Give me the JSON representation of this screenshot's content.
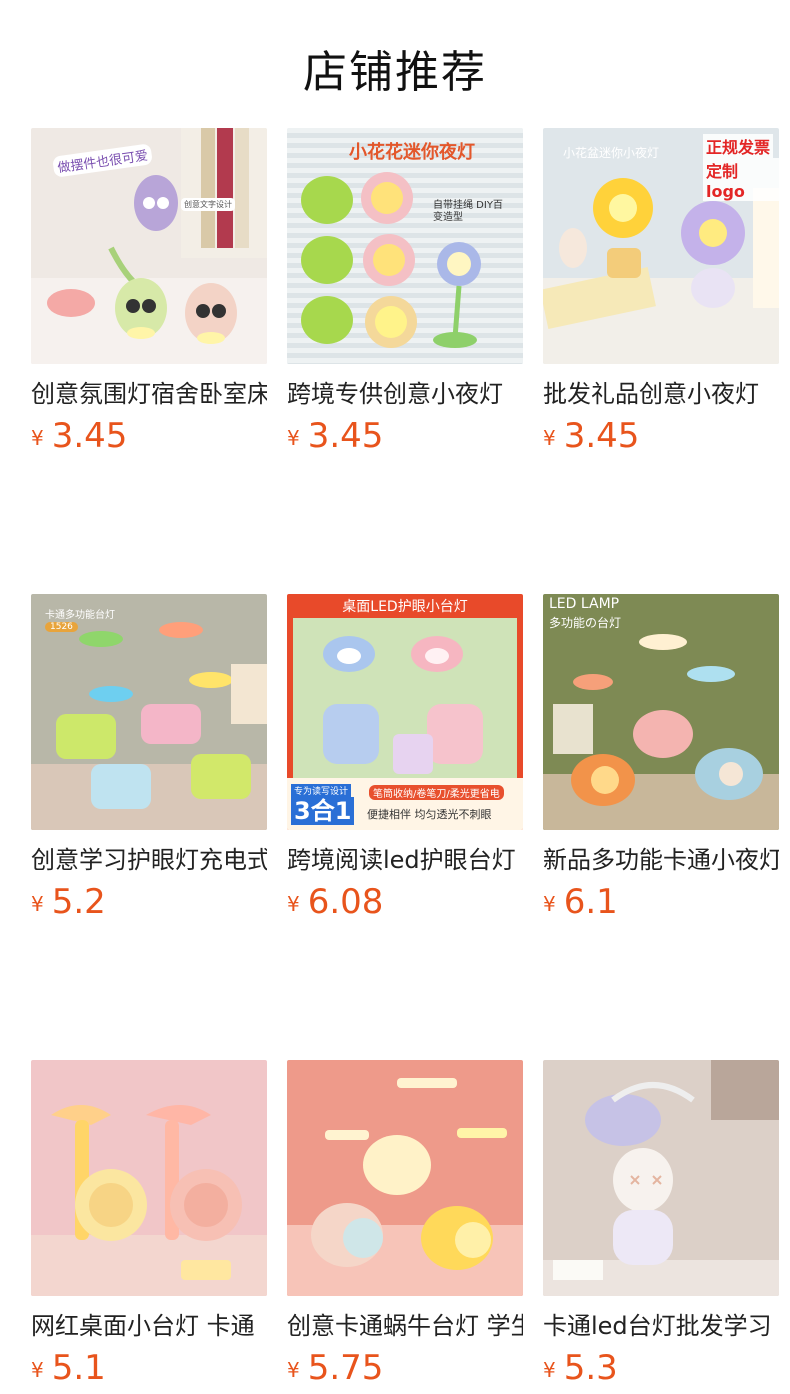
{
  "page": {
    "title": "店铺推荐"
  },
  "products": [
    {
      "name": "创意氛围灯宿舍卧室床头",
      "currency": "¥",
      "price": "3.45",
      "image": {
        "caption": "做摆件也很可爱",
        "alt_caption": "创意文字设计"
      }
    },
    {
      "name": "跨境专供创意小夜灯",
      "currency": "¥",
      "price": "3.45",
      "image": {
        "caption": "小花花迷你夜灯",
        "alt_caption": "自带挂绳 DIY百变造型"
      }
    },
    {
      "name": "批发礼品创意小夜灯",
      "currency": "¥",
      "price": "3.45",
      "image": {
        "caption": "小花盆迷你小夜灯",
        "badge_line1": "正规发票",
        "badge_line2": "定制logo"
      }
    },
    {
      "name": "创意学习护眼灯充电式",
      "currency": "¥",
      "price": "5.2",
      "image": {
        "caption": "卡通多功能台灯",
        "tag": "1526"
      }
    },
    {
      "name": "跨境阅读led护眼台灯",
      "currency": "¥",
      "price": "6.08",
      "image": {
        "caption": "桌面LED护眼小台灯",
        "tag": "专为读写设计",
        "tag_big": "3合1",
        "sub1": "笔筒收纳/卷笔刀/柔光更省电",
        "sub2": "便捷相伴 均匀透光不刺眼"
      }
    },
    {
      "name": "新品多功能卡通小夜灯",
      "currency": "¥",
      "price": "6.1",
      "image": {
        "caption": "LED LAMP",
        "sub1": "多功能の台灯"
      }
    },
    {
      "name": "网红桌面小台灯 卡通",
      "currency": "¥",
      "price": "5.1",
      "image": {}
    },
    {
      "name": "创意卡通蜗牛台灯 学生",
      "currency": "¥",
      "price": "5.75",
      "image": {}
    },
    {
      "name": "卡通led台灯批发学习",
      "currency": "¥",
      "price": "5.3",
      "image": {}
    }
  ],
  "colors": {
    "price": "#e8541c",
    "title": "#111111",
    "name": "#222222"
  }
}
